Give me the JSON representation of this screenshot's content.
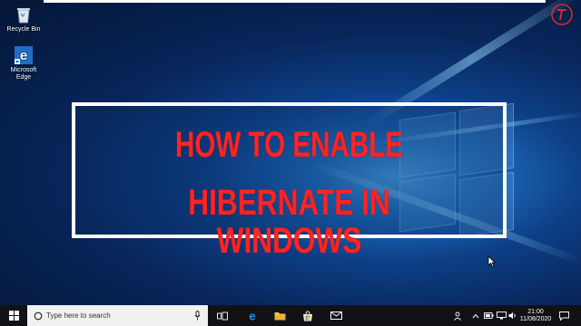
{
  "desktop": {
    "icons": [
      {
        "label": "Recycle Bin",
        "icon": "recycle-bin-icon"
      },
      {
        "label": "Microsoft\nEdge",
        "icon": "edge-icon"
      }
    ]
  },
  "title": {
    "line1": "HOW TO ENABLE",
    "line2": "HIBERNATE IN WINDOWS",
    "color": "#ff2323"
  },
  "taskbar": {
    "search_placeholder": "Type here to search",
    "apps": [
      "task-view-icon",
      "edge-icon",
      "file-explorer-icon",
      "store-icon",
      "mail-icon"
    ],
    "tray": {
      "time": "21:00",
      "date": "11/08/2020"
    }
  },
  "colors": {
    "taskbar": "#101216",
    "accent": "#0078d7"
  }
}
